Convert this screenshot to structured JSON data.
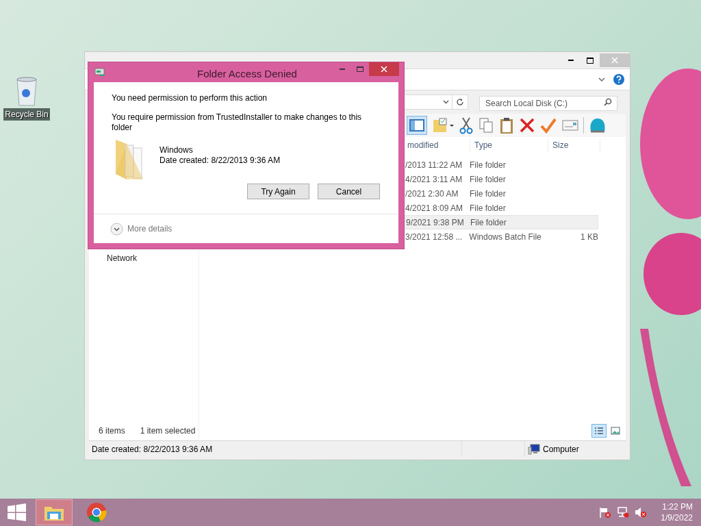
{
  "desktop_icons": [
    {
      "label": "Recycle Bin"
    }
  ],
  "explorer": {
    "search": {
      "placeholder": "Search Local Disk (C:)"
    },
    "columns": [
      "modified",
      "Type",
      "Size"
    ],
    "rows": [
      {
        "modified": "/2013 11:22 AM",
        "type": "File folder",
        "size": "",
        "selected": false
      },
      {
        "modified": "4/2021 3:11 AM",
        "type": "File folder",
        "size": "",
        "selected": false
      },
      {
        "modified": "/2021 2:30 AM",
        "type": "File folder",
        "size": "",
        "selected": false
      },
      {
        "modified": "4/2021 8:09 AM",
        "type": "File folder",
        "size": "",
        "selected": false
      },
      {
        "modified": "9/2021 9:38 PM",
        "type": "File folder",
        "size": "",
        "selected": true
      },
      {
        "modified": "3/2021 12:58 ...",
        "type": "Windows Batch File",
        "size": "1 KB",
        "selected": false
      }
    ],
    "nav_items": [
      "Network"
    ],
    "item_count": "6 items",
    "selection_count": "1 item selected",
    "views": [
      {
        "kind": "details",
        "selected": true
      },
      {
        "kind": "thumbnails",
        "selected": false
      }
    ],
    "status_bar": {
      "details": "Date created: 8/22/2013 9:36 AM",
      "location": "Computer"
    }
  },
  "dialog": {
    "title": "Folder Access Denied",
    "heading": "You need permission to perform this action",
    "message": "You require permission from TrustedInstaller to make changes to this folder",
    "item": {
      "name": "Windows",
      "details": "Date created: 8/22/2013 9:36 AM"
    },
    "buttons": [
      "Try Again",
      "Cancel"
    ],
    "more_details": "More details"
  },
  "taskbar": {
    "apps": [
      {
        "kind": "explorer",
        "selected": true
      },
      {
        "kind": "chrome",
        "selected": false
      }
    ],
    "time": "1:22 PM",
    "date": "1/9/2022"
  }
}
